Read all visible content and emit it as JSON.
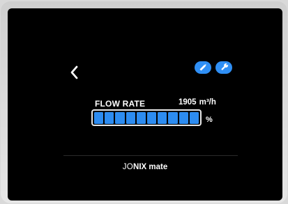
{
  "screen": {
    "title": "FLOW RATE",
    "flow_value": "1905",
    "flow_unit": "m³/h",
    "percent_symbol": "%",
    "level_segments_total": 10,
    "level_segments_on": 10,
    "level_fraction": 1.0,
    "brand_part1": "JO",
    "brand_part2": "NIX mate"
  },
  "buttons": {
    "back_icon": "chevron-left-icon",
    "edit_icon": "pencil-icon",
    "settings_icon": "wrench-icon"
  },
  "colors": {
    "accent": "#2d8cf0",
    "button_blue": "#2f8ff5",
    "screen_bg": "#000000",
    "text": "#ffffff"
  }
}
